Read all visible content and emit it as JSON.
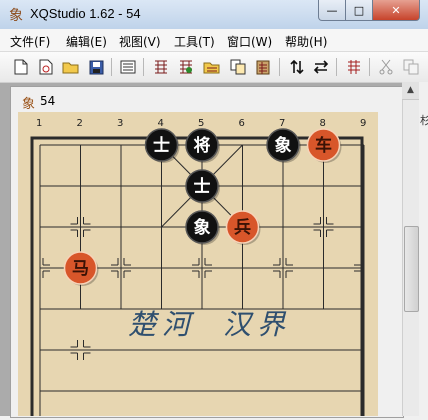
{
  "window": {
    "title": "XQStudio 1.62 - 54",
    "app_icon": "象",
    "min_label": "—",
    "max_label": "□",
    "close_label": "✕"
  },
  "menu": [
    {
      "label": "文件(F)"
    },
    {
      "label": "编辑(E)"
    },
    {
      "label": "视图(V)"
    },
    {
      "label": "工具(T)"
    },
    {
      "label": "窗口(W)"
    },
    {
      "label": "帮助(H)"
    }
  ],
  "toolbar": {
    "icons": [
      "new-document-icon",
      "new-game-icon",
      "open-folder-icon",
      "save-icon",
      "notes-icon",
      "edit-board-icon",
      "board-tools-icon",
      "copy-board-icon",
      "paste-board-icon",
      "flip-vertical-icon",
      "flip-horizontal-icon",
      "move-list-icon",
      "cut-icon",
      "copy-icon"
    ]
  },
  "child_window": {
    "icon": "象",
    "title": "54",
    "right_marker": "杉"
  },
  "board": {
    "file_numbers": [
      "1",
      "2",
      "3",
      "4",
      "5",
      "6",
      "7",
      "8",
      "9"
    ],
    "river_left": "楚河",
    "river_right": "汉界",
    "pieces": [
      {
        "char": "士",
        "side": "black",
        "file": 4,
        "rank": 0
      },
      {
        "char": "将",
        "side": "black",
        "file": 5,
        "rank": 0
      },
      {
        "char": "象",
        "side": "black",
        "file": 7,
        "rank": 0
      },
      {
        "char": "车",
        "side": "red",
        "file": 8,
        "rank": 0
      },
      {
        "char": "士",
        "side": "black",
        "file": 5,
        "rank": 1
      },
      {
        "char": "象",
        "side": "black",
        "file": 5,
        "rank": 2
      },
      {
        "char": "兵",
        "side": "red",
        "file": 6,
        "rank": 2
      },
      {
        "char": "马",
        "side": "red",
        "file": 2,
        "rank": 3
      }
    ],
    "colors": {
      "board": "#e7d6b1",
      "line": "#2b2b2b",
      "black_piece": "#111111",
      "red_piece": "#d8562a",
      "river_text": "#2f4f6f"
    }
  }
}
